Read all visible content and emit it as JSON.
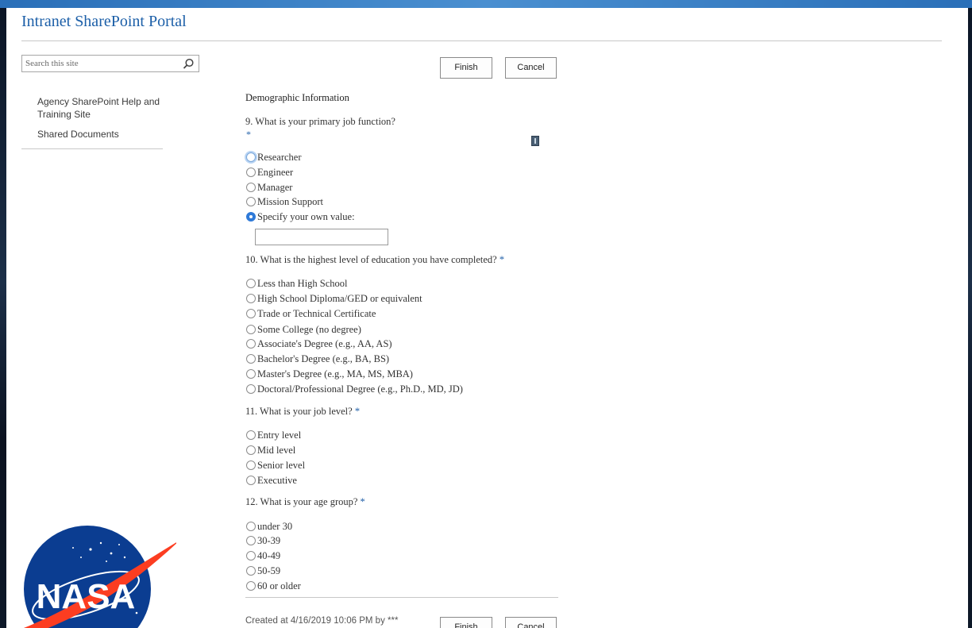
{
  "site": {
    "title": "Intranet SharePoint Portal"
  },
  "search": {
    "placeholder": "Search this site"
  },
  "nav": {
    "items": [
      "Agency SharePoint Help and Training Site",
      "Shared Documents"
    ]
  },
  "toolbar": {
    "finish_label": "Finish",
    "cancel_label": "Cancel"
  },
  "form": {
    "heading": "Demographic Information",
    "required_mark": "*",
    "questions": [
      {
        "label": "9. What is your primary job function?",
        "options": [
          "Researcher",
          "Engineer",
          "Manager",
          "Mission Support",
          "Specify your own value:"
        ],
        "selected": "Specify your own value:",
        "own_value": ""
      },
      {
        "label": "10. What is the highest level of education you have completed?",
        "options": [
          "Less than High School",
          "High School Diploma/GED or equivalent",
          "Trade or Technical Certificate",
          "Some College (no degree)",
          "Associate's Degree (e.g., AA, AS)",
          "Bachelor's Degree (e.g., BA, BS)",
          "Master's Degree (e.g., MA, MS, MBA)",
          "Doctoral/Professional Degree (e.g., Ph.D., MD, JD)"
        ]
      },
      {
        "label": "11. What is your job level?",
        "options": [
          "Entry level",
          "Mid level",
          "Senior level",
          "Executive"
        ]
      },
      {
        "label": "12. What is your age group?",
        "options": [
          "under 30",
          "30-39",
          "40-49",
          "50-59",
          "60 or older"
        ]
      }
    ]
  },
  "footer": {
    "created": "Created at 4/16/2019 10:06 PM by ***"
  },
  "logo": {
    "text": "NASA"
  },
  "colors": {
    "title_blue": "#1c5fa8",
    "accent_blue": "#2f7ad8",
    "nasa_blue": "#0b3d91",
    "nasa_red": "#fc3d21"
  }
}
